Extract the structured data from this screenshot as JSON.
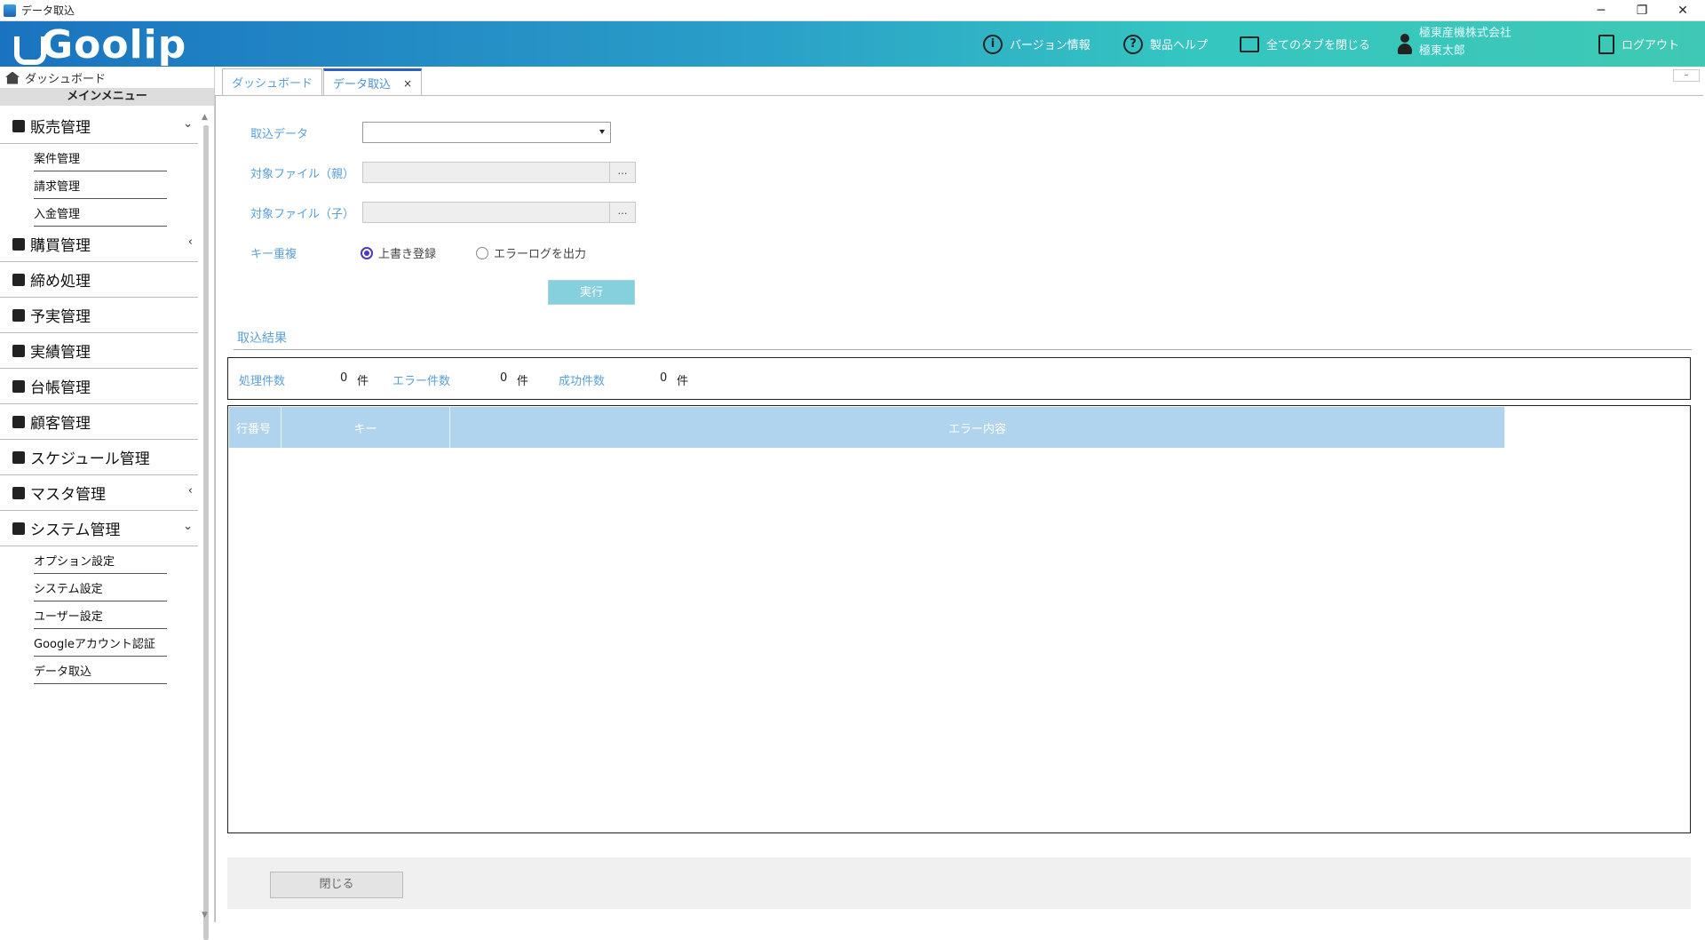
{
  "window": {
    "title": "データ取込",
    "minimize": "─",
    "restore": "❐",
    "close": "✕"
  },
  "header": {
    "logo": "Goolip",
    "version_info": "バージョン情報",
    "help": "製品ヘルプ",
    "close_all_tabs": "全てのタブを閉じる",
    "company": "極東産機株式会社",
    "user": "極東太郎",
    "logout": "ログアウト"
  },
  "sidebar": {
    "dashboard": "ダッシュボード",
    "menu_title": "メインメニュー",
    "groups": [
      {
        "label": "販売管理",
        "chevron": "⌄",
        "subs": [
          "案件管理",
          "請求管理",
          "入金管理"
        ]
      },
      {
        "label": "購買管理",
        "chevron": "‹",
        "subs": []
      },
      {
        "label": "締め処理",
        "chevron": "",
        "subs": []
      },
      {
        "label": "予実管理",
        "chevron": "",
        "subs": []
      },
      {
        "label": "実績管理",
        "chevron": "",
        "subs": []
      },
      {
        "label": "台帳管理",
        "chevron": "",
        "subs": []
      },
      {
        "label": "顧客管理",
        "chevron": "",
        "subs": []
      },
      {
        "label": "スケジュール管理",
        "chevron": "",
        "subs": []
      },
      {
        "label": "マスタ管理",
        "chevron": "‹",
        "subs": []
      },
      {
        "label": "システム管理",
        "chevron": "⌄",
        "subs": [
          "オプション設定",
          "システム設定",
          "ユーザー設定",
          "Googleアカウント認証",
          "データ取込"
        ]
      }
    ]
  },
  "tabs": {
    "dashboard": "ダッシュボード",
    "import": "データ取込",
    "close_x": "×",
    "minimize": "–"
  },
  "form": {
    "import_data_label": "取込データ",
    "parent_file_label": "対象ファイル（親）",
    "child_file_label": "対象ファイル（子）",
    "browse": "…",
    "key_dup_label": "キー重複",
    "overwrite": "上書き登録",
    "error_log": "エラーログを出力",
    "execute": "実行"
  },
  "result": {
    "title": "取込結果",
    "processed_label": "処理件数",
    "processed_value": "0",
    "unit1": "件",
    "error_label": "エラー件数",
    "error_value": "0",
    "unit2": "件",
    "success_label": "成功件数",
    "success_value": "0",
    "unit3": "件",
    "columns": [
      "行番号",
      "キー",
      "エラー内容"
    ]
  },
  "footer": {
    "close": "閉じる"
  }
}
